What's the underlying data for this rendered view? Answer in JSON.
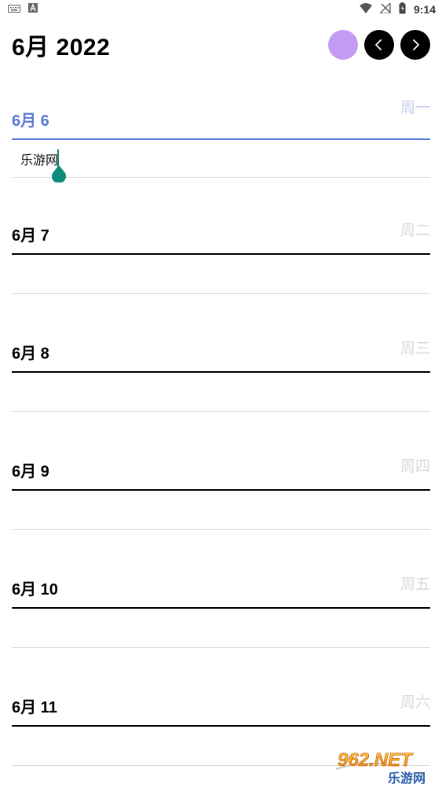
{
  "status_bar": {
    "time": "9:14",
    "left_icons": [
      "keyboard-icon",
      "a-badge-icon"
    ],
    "right_icons": [
      "wifi-icon",
      "no-signal-icon",
      "battery-icon"
    ]
  },
  "header": {
    "title": "6月 2022",
    "color_dot": "#c39bf5",
    "prev_icon": "chevron-left-icon",
    "next_icon": "chevron-right-icon"
  },
  "days": [
    {
      "label": "6月 6",
      "weekday": "周一",
      "note": "乐游网",
      "active": true
    },
    {
      "label": "6月 7",
      "weekday": "周二",
      "note": ""
    },
    {
      "label": "6月 8",
      "weekday": "周三",
      "note": ""
    },
    {
      "label": "6月 9",
      "weekday": "周四",
      "note": ""
    },
    {
      "label": "6月 10",
      "weekday": "周五",
      "note": ""
    },
    {
      "label": "6月 11",
      "weekday": "周六",
      "note": ""
    }
  ],
  "colors": {
    "accent": "#5b78d6",
    "cursor": "#0f8a78",
    "weekday": "#d9d9d9"
  },
  "watermark": {
    "top": "962.NET",
    "bottom": "乐游网"
  }
}
